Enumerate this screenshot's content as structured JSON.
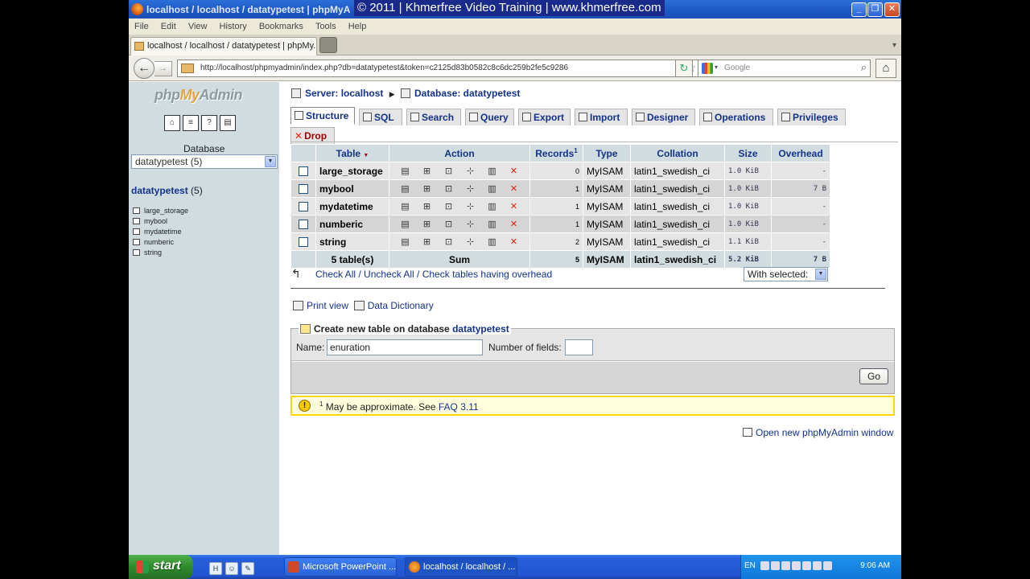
{
  "window": {
    "title": "localhost / localhost / datatypetest | phpMyA",
    "watermark": "© 2011 | Khmerfree Video Training | www.khmerfree.com",
    "min_label": "_",
    "max_label": "❐",
    "close_label": "✕"
  },
  "menu": [
    "File",
    "Edit",
    "View",
    "History",
    "Bookmarks",
    "Tools",
    "Help"
  ],
  "browser_tab": {
    "title": "localhost / localhost / datatypetest | phpMy..."
  },
  "nav": {
    "url": "http://localhost/phpmyadmin/index.php?db=datatypetest&token=c2125d83b0582c8c6dc259b2fe5c9286",
    "search_placeholder": "Google"
  },
  "left": {
    "logo_php": "php",
    "logo_my": "My",
    "logo_admin": "Admin",
    "icons": [
      "home-icon",
      "sql-icon",
      "help-icon",
      "docs-icon"
    ],
    "database_label": "Database",
    "database_select": "datatypetest (5)",
    "db_name": "datatypetest",
    "db_count": " (5)",
    "tables": [
      "large_storage",
      "mybool",
      "mydatetime",
      "numberic",
      "string"
    ]
  },
  "main": {
    "breadcrumb_server": "Server: localhost",
    "breadcrumb_db": "Database: datatypetest",
    "tabs": [
      {
        "label": "Structure"
      },
      {
        "label": "SQL"
      },
      {
        "label": "Search"
      },
      {
        "label": "Query"
      },
      {
        "label": "Export"
      },
      {
        "label": "Import"
      },
      {
        "label": "Designer"
      },
      {
        "label": "Operations"
      },
      {
        "label": "Privileges"
      }
    ],
    "drop_tab": "Drop",
    "table_headers": {
      "table": "Table",
      "table_sort": "▼",
      "action": "Action",
      "records": "Records",
      "records_sup": "1",
      "type": "Type",
      "collation": "Collation",
      "size": "Size",
      "overhead": "Overhead"
    },
    "rows": [
      {
        "name": "large_storage",
        "records": "0",
        "type": "MyISAM",
        "collation": "latin1_swedish_ci",
        "size": "1.0 KiB",
        "overhead": "-"
      },
      {
        "name": "mybool",
        "records": "1",
        "type": "MyISAM",
        "collation": "latin1_swedish_ci",
        "size": "1.0 KiB",
        "overhead": "7 B"
      },
      {
        "name": "mydatetime",
        "records": "1",
        "type": "MyISAM",
        "collation": "latin1_swedish_ci",
        "size": "1.0 KiB",
        "overhead": "-"
      },
      {
        "name": "numberic",
        "records": "1",
        "type": "MyISAM",
        "collation": "latin1_swedish_ci",
        "size": "1.0 KiB",
        "overhead": "-"
      },
      {
        "name": "string",
        "records": "2",
        "type": "MyISAM",
        "collation": "latin1_swedish_ci",
        "size": "1.1 KiB",
        "overhead": "-"
      }
    ],
    "sum": {
      "tables": "5 table(s)",
      "label": "Sum",
      "records": "5",
      "type": "MyISAM",
      "collation": "latin1_swedish_ci",
      "size": "5.2 KiB",
      "overhead": "7 B"
    },
    "check_all": "Check All / Uncheck All / Check tables having overhead",
    "with_selected": "With selected:",
    "print_view": "Print view",
    "data_dictionary": "Data Dictionary",
    "create_legend": "Create new table on database ",
    "create_db": "datatypetest",
    "name_label": "Name:",
    "name_value": "enuration",
    "fields_label": "Number of fields:",
    "go": "Go",
    "notice_sup": "1",
    "notice_text": " May be approximate. See ",
    "notice_faq": "FAQ 3.11",
    "open_window": "Open new phpMyAdmin window"
  },
  "taskbar": {
    "start": "start",
    "btn_ppt": "Microsoft PowerPoint ...",
    "btn_ff": "localhost / localhost / ...",
    "lang": "EN",
    "clock": "9:06 AM"
  }
}
